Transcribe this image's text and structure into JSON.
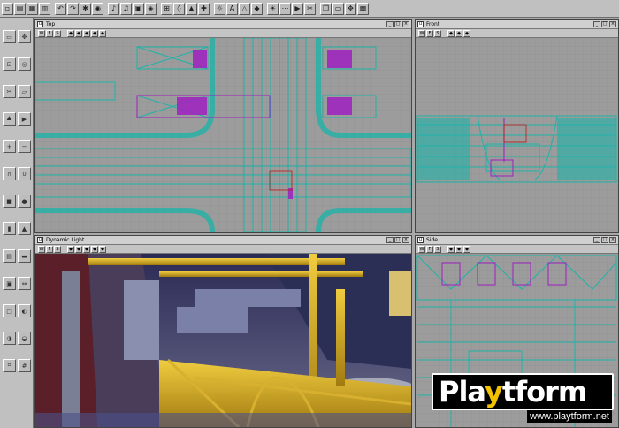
{
  "toolbar": {
    "icons": [
      "new-file-icon",
      "open-file-icon",
      "save-file-icon",
      "save-all-icon",
      "undo-icon",
      "redo-icon",
      "find-icon",
      "camera-icon",
      "brush-icon",
      "texture-icon",
      "music-icon",
      "sound-icon",
      "mesh-icon",
      "actor-icon",
      "class-icon",
      "group-icon",
      "light-icon",
      "text-icon",
      "build-icon",
      "geometry-icon",
      "lighting-icon",
      "paths-icon",
      "play-icon",
      "cut-icon",
      "copy-icon",
      "paste-icon",
      "move-icon",
      "prefab-icon"
    ]
  },
  "viewports": {
    "top": {
      "title": "Top",
      "bar": [
        "W",
        "F",
        "S"
      ]
    },
    "front": {
      "title": "Front",
      "bar": [
        "W",
        "F",
        "S"
      ]
    },
    "dyn": {
      "title": "Dynamic Light",
      "bar": [
        "W",
        "F",
        "S"
      ]
    },
    "side": {
      "title": "Side",
      "bar": [
        "W",
        "F",
        "S"
      ]
    }
  },
  "window_buttons": [
    "_",
    "□",
    "×"
  ],
  "logo": {
    "pre": "Pla",
    "y": "y",
    "post": "tform",
    "url": "www.playtform.net"
  },
  "colors": {
    "wire": "#1fb3a8",
    "brush": "#a020c0",
    "grid_bg": "#9c9c9c",
    "metal": "#d8b030"
  }
}
